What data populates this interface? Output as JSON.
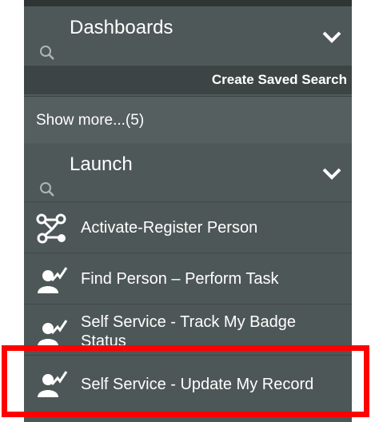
{
  "dashboards": {
    "title": "Dashboards",
    "search_icon": "search-icon",
    "chevron_icon": "chevron-down-icon"
  },
  "saved_search": {
    "label": "Create Saved Search"
  },
  "show_more": {
    "label": "Show more...(5)"
  },
  "launch": {
    "title": "Launch",
    "search_icon": "search-icon",
    "chevron_icon": "chevron-down-icon"
  },
  "launch_items": [
    {
      "label": "Activate-Register Person",
      "icon": "workflow-icon"
    },
    {
      "label": "Find Person – Perform Task",
      "icon": "person-task-icon"
    },
    {
      "label": "Self Service - Track My Badge Status",
      "icon": "person-task-icon"
    },
    {
      "label": "Self Service - Update My Record",
      "icon": "person-task-icon"
    }
  ],
  "colors": {
    "panel": "#515b5b",
    "highlight": "#ff0000",
    "text": "#ffffff"
  }
}
